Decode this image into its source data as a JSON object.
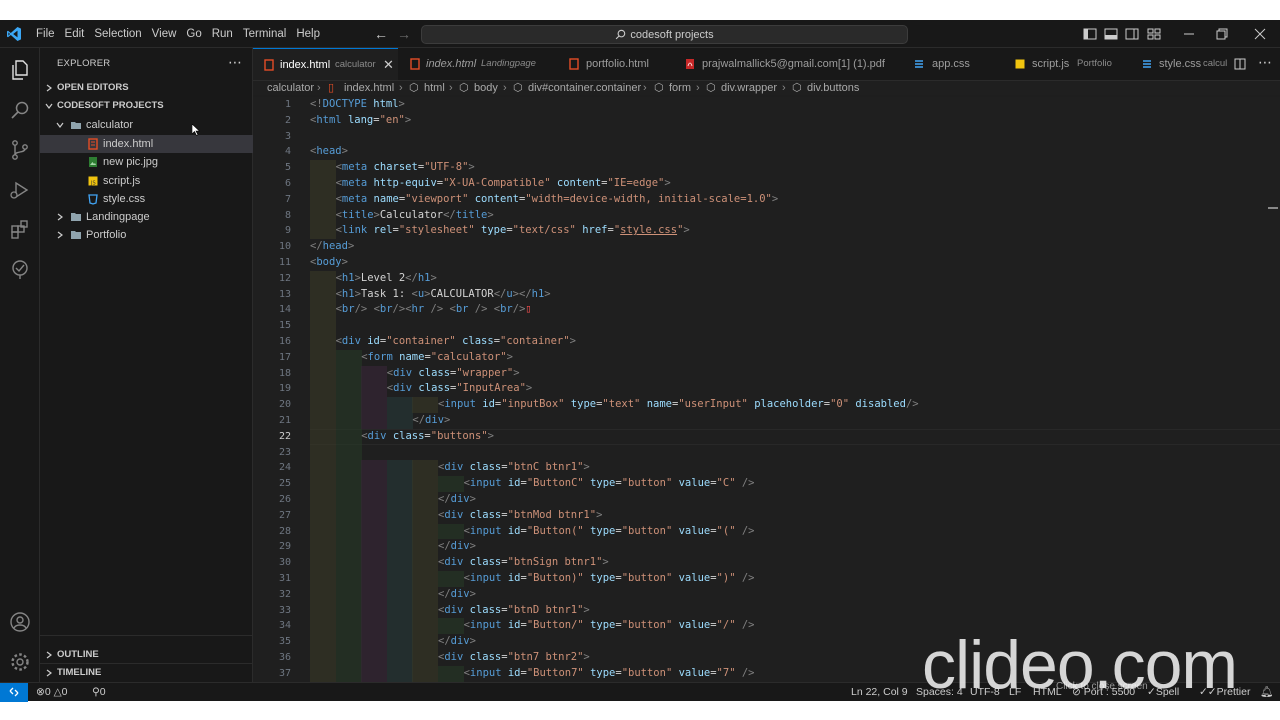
{
  "titlebar": {
    "menus": [
      "File",
      "Edit",
      "Selection",
      "View",
      "Go",
      "Run",
      "Terminal",
      "Help"
    ],
    "command_center": "codesoft projects"
  },
  "sidebar": {
    "title": "EXPLORER",
    "open_editors": "OPEN EDITORS",
    "project": "CODESOFT PROJECTS",
    "items": [
      {
        "label": "calculator",
        "type": "folder",
        "open": true
      },
      {
        "label": "index.html",
        "type": "html"
      },
      {
        "label": "new pic.jpg",
        "type": "image"
      },
      {
        "label": "script.js",
        "type": "js"
      },
      {
        "label": "style.css",
        "type": "css"
      },
      {
        "label": "Landingpage",
        "type": "folder",
        "open": false
      },
      {
        "label": "Portfolio",
        "type": "folder",
        "open": false
      }
    ],
    "outline": "OUTLINE",
    "timeline": "TIMELINE"
  },
  "tabs": [
    {
      "name": "index.html",
      "sub": "calculator",
      "icon": "html",
      "active": true
    },
    {
      "name": "index.html",
      "sub": "Landingpage",
      "icon": "html",
      "italic": true
    },
    {
      "name": "portfolio.html",
      "sub": "",
      "icon": "html"
    },
    {
      "name": "prajwalmallick5@gmail.com[1] (1).pdf",
      "sub": "",
      "icon": "pdf"
    },
    {
      "name": "app.css",
      "sub": "",
      "icon": "css"
    },
    {
      "name": "script.js",
      "sub": "Portfolio",
      "icon": "js"
    },
    {
      "name": "style.css",
      "sub": "calcul",
      "icon": "css"
    }
  ],
  "breadcrumbs": [
    "calculator",
    "index.html",
    "html",
    "body",
    "div#container.container",
    "form",
    "div.wrapper",
    "div.buttons"
  ],
  "code_lines": [
    {
      "n": "1",
      "indent": 0,
      "html": "<span class='t-br'>&lt;!</span><span class='t-tag'>DOCTYPE</span> <span class='t-attr'>html</span><span class='t-br'>&gt;</span>"
    },
    {
      "n": "2",
      "indent": 0,
      "html": "<span class='t-br'>&lt;</span><span class='t-tag'>html</span> <span class='t-attr'>lang</span>=<span class='t-str'>\"en\"</span><span class='t-br'>&gt;</span>"
    },
    {
      "n": "3",
      "indent": 0,
      "html": ""
    },
    {
      "n": "4",
      "indent": 0,
      "html": "<span class='t-br'>&lt;</span><span class='t-tag'>head</span><span class='t-br'>&gt;</span>"
    },
    {
      "n": "5",
      "indent": 1,
      "html": "<span class='t-br'>&lt;</span><span class='t-tag'>meta</span> <span class='t-attr'>charset</span>=<span class='t-str'>\"UTF-8\"</span><span class='t-br'>&gt;</span>"
    },
    {
      "n": "6",
      "indent": 1,
      "html": "<span class='t-br'>&lt;</span><span class='t-tag'>meta</span> <span class='t-attr'>http-equiv</span>=<span class='t-str'>\"X-UA-Compatible\"</span> <span class='t-attr'>content</span>=<span class='t-str'>\"IE=edge\"</span><span class='t-br'>&gt;</span>"
    },
    {
      "n": "7",
      "indent": 1,
      "html": "<span class='t-br'>&lt;</span><span class='t-tag'>meta</span> <span class='t-attr'>name</span>=<span class='t-str'>\"viewport\"</span> <span class='t-attr'>content</span>=<span class='t-str'>\"width=device-width, initial-scale=1.0\"</span><span class='t-br'>&gt;</span>"
    },
    {
      "n": "8",
      "indent": 1,
      "html": "<span class='t-br'>&lt;</span><span class='t-tag'>title</span><span class='t-br'>&gt;</span><span class='t-txt'>Calculator</span><span class='t-br'>&lt;/</span><span class='t-tag'>title</span><span class='t-br'>&gt;</span>"
    },
    {
      "n": "9",
      "indent": 1,
      "html": "<span class='t-br'>&lt;</span><span class='t-tag'>link</span> <span class='t-attr'>rel</span>=<span class='t-str'>\"stylesheet\"</span> <span class='t-attr'>type</span>=<span class='t-str'>\"text/css\"</span> <span class='t-attr'>href</span>=<span class='t-str'>\"<u>style.css</u>\"</span><span class='t-br'>&gt;</span>"
    },
    {
      "n": "10",
      "indent": 0,
      "html": "<span class='t-br'>&lt;/</span><span class='t-tag'>head</span><span class='t-br'>&gt;</span>"
    },
    {
      "n": "11",
      "indent": 0,
      "html": "<span class='t-br'>&lt;</span><span class='t-tag'>body</span><span class='t-br'>&gt;</span>"
    },
    {
      "n": "12",
      "indent": 1,
      "html": "<span class='t-br'>&lt;</span><span class='t-tag'>h1</span><span class='t-br'>&gt;</span><span class='t-txt'>Level 2</span><span class='t-br'>&lt;/</span><span class='t-tag'>h1</span><span class='t-br'>&gt;</span>"
    },
    {
      "n": "13",
      "indent": 1,
      "html": "<span class='t-br'>&lt;</span><span class='t-tag'>h1</span><span class='t-br'>&gt;</span><span class='t-txt'>Task 1: </span><span class='t-br'>&lt;</span><span class='t-tag'>u</span><span class='t-br'>&gt;</span><span class='t-txt'>CALCULATOR</span><span class='t-br'>&lt;/</span><span class='t-tag'>u</span><span class='t-br'>&gt;&lt;/</span><span class='t-tag'>h1</span><span class='t-br'>&gt;</span>"
    },
    {
      "n": "14",
      "indent": 1,
      "html": "<span class='t-br'>&lt;</span><span class='t-tag'>br</span><span class='t-br'>/&gt;</span> <span class='t-br'>&lt;</span><span class='t-tag'>br</span><span class='t-br'>/&gt;&lt;</span><span class='t-tag'>hr</span> <span class='t-br'>/&gt;</span> <span class='t-br'>&lt;</span><span class='t-tag'>br</span> <span class='t-br'>/&gt;</span> <span class='t-br'>&lt;</span><span class='t-tag'>br</span><span class='t-br'>/&gt;</span><span class='t-err'>▯</span>"
    },
    {
      "n": "15",
      "indent": 1,
      "html": ""
    },
    {
      "n": "16",
      "indent": 1,
      "html": "<span class='t-br'>&lt;</span><span class='t-tag'>div</span> <span class='t-attr'>id</span>=<span class='t-str'>\"container\"</span> <span class='t-attr'>class</span>=<span class='t-str'>\"container\"</span><span class='t-br'>&gt;</span>"
    },
    {
      "n": "17",
      "indent": 2,
      "html": "<span class='t-br'>&lt;</span><span class='t-tag'>form</span> <span class='t-attr'>name</span>=<span class='t-str'>\"calculator\"</span><span class='t-br'>&gt;</span>"
    },
    {
      "n": "18",
      "indent": 3,
      "html": "<span class='t-br'>&lt;</span><span class='t-tag'>div</span> <span class='t-attr'>class</span>=<span class='t-str'>\"wrapper\"</span><span class='t-br'>&gt;</span>"
    },
    {
      "n": "19",
      "indent": 3,
      "html": "<span class='t-br'>&lt;</span><span class='t-tag'>div</span> <span class='t-attr'>class</span>=<span class='t-str'>\"InputArea\"</span><span class='t-br'>&gt;</span>"
    },
    {
      "n": "20",
      "indent": 5,
      "html": "<span class='t-br'>&lt;</span><span class='t-tag'>input</span> <span class='t-attr'>id</span>=<span class='t-str'>\"inputBox\"</span> <span class='t-attr'>type</span>=<span class='t-str'>\"text\"</span> <span class='t-attr'>name</span>=<span class='t-str'>\"userInput\"</span> <span class='t-attr'>placeholder</span>=<span class='t-str'>\"0\"</span> <span class='t-attr'>disabled</span><span class='t-br'>/&gt;</span>"
    },
    {
      "n": "21",
      "indent": 4,
      "html": "<span class='t-br'>&lt;/</span><span class='t-tag'>div</span><span class='t-br'>&gt;</span>"
    },
    {
      "n": "22",
      "indent": 2,
      "html": "<span class='t-br'>&lt;</span><span class='t-tag'>div</span> <span class='t-attr'>class</span>=<span class='t-str'>\"buttons\"</span><span class='t-br'>&gt;</span>",
      "current": true
    },
    {
      "n": "23",
      "indent": 0,
      "html": ""
    },
    {
      "n": "24",
      "indent": 5,
      "html": "<span class='t-br'>&lt;</span><span class='t-tag'>div</span> <span class='t-attr'>class</span>=<span class='t-str'>\"btnC btnr1\"</span><span class='t-br'>&gt;</span>"
    },
    {
      "n": "25",
      "indent": 6,
      "html": "<span class='t-br'>&lt;</span><span class='t-tag'>input</span> <span class='t-attr'>id</span>=<span class='t-str'>\"ButtonC\"</span> <span class='t-attr'>type</span>=<span class='t-str'>\"button\"</span> <span class='t-attr'>value</span>=<span class='t-str'>\"C\"</span> <span class='t-br'>/&gt;</span>"
    },
    {
      "n": "26",
      "indent": 5,
      "html": "<span class='t-br'>&lt;/</span><span class='t-tag'>div</span><span class='t-br'>&gt;</span>"
    },
    {
      "n": "27",
      "indent": 5,
      "html": "<span class='t-br'>&lt;</span><span class='t-tag'>div</span> <span class='t-attr'>class</span>=<span class='t-str'>\"btnMod btnr1\"</span><span class='t-br'>&gt;</span>"
    },
    {
      "n": "28",
      "indent": 6,
      "html": "<span class='t-br'>&lt;</span><span class='t-tag'>input</span> <span class='t-attr'>id</span>=<span class='t-str'>\"Button(\"</span> <span class='t-attr'>type</span>=<span class='t-str'>\"button\"</span> <span class='t-attr'>value</span>=<span class='t-str'>\"(\"</span> <span class='t-br'>/&gt;</span>"
    },
    {
      "n": "29",
      "indent": 5,
      "html": "<span class='t-br'>&lt;/</span><span class='t-tag'>div</span><span class='t-br'>&gt;</span>"
    },
    {
      "n": "30",
      "indent": 5,
      "html": "<span class='t-br'>&lt;</span><span class='t-tag'>div</span> <span class='t-attr'>class</span>=<span class='t-str'>\"btnSign btnr1\"</span><span class='t-br'>&gt;</span>"
    },
    {
      "n": "31",
      "indent": 6,
      "html": "<span class='t-br'>&lt;</span><span class='t-tag'>input</span> <span class='t-attr'>id</span>=<span class='t-str'>\"Button)\"</span> <span class='t-attr'>type</span>=<span class='t-str'>\"button\"</span> <span class='t-attr'>value</span>=<span class='t-str'>\")\"</span> <span class='t-br'>/&gt;</span>"
    },
    {
      "n": "32",
      "indent": 5,
      "html": "<span class='t-br'>&lt;/</span><span class='t-tag'>div</span><span class='t-br'>&gt;</span>"
    },
    {
      "n": "33",
      "indent": 5,
      "html": "<span class='t-br'>&lt;</span><span class='t-tag'>div</span> <span class='t-attr'>class</span>=<span class='t-str'>\"btnD btnr1\"</span><span class='t-br'>&gt;</span>"
    },
    {
      "n": "34",
      "indent": 6,
      "html": "<span class='t-br'>&lt;</span><span class='t-tag'>input</span> <span class='t-attr'>id</span>=<span class='t-str'>\"Button/\"</span> <span class='t-attr'>type</span>=<span class='t-str'>\"button\"</span> <span class='t-attr'>value</span>=<span class='t-str'>\"/\"</span> <span class='t-br'>/&gt;</span>"
    },
    {
      "n": "35",
      "indent": 5,
      "html": "<span class='t-br'>&lt;/</span><span class='t-tag'>div</span><span class='t-br'>&gt;</span>"
    },
    {
      "n": "36",
      "indent": 5,
      "html": "<span class='t-br'>&lt;</span><span class='t-tag'>div</span> <span class='t-attr'>class</span>=<span class='t-str'>\"btn7 btnr2\"</span><span class='t-br'>&gt;</span>"
    },
    {
      "n": "37",
      "indent": 6,
      "html": "<span class='t-br'>&lt;</span><span class='t-tag'>input</span> <span class='t-attr'>id</span>=<span class='t-str'>\"Button7\"</span> <span class='t-attr'>type</span>=<span class='t-str'>\"button\"</span> <span class='t-attr'>value</span>=<span class='t-str'>\"7\"</span> <span class='t-br'>/&gt;</span>"
    }
  ],
  "statusbar": {
    "errors": "0",
    "warnings": "0",
    "ports": "0",
    "cursor": "Ln 22, Col 9",
    "spaces": "Spaces: 4",
    "encoding": "UTF-8",
    "eol": "LF",
    "language": "HTML",
    "port": "Port : 5500",
    "spell": "Spell",
    "prettier": "Prettier"
  },
  "watermark": {
    "text": "clideo.com",
    "sub": "Click to close screen"
  },
  "colors": {
    "accent": "#0078d4",
    "tag": "#569cd6",
    "attr": "#9cdcfe",
    "string": "#ce9178"
  }
}
